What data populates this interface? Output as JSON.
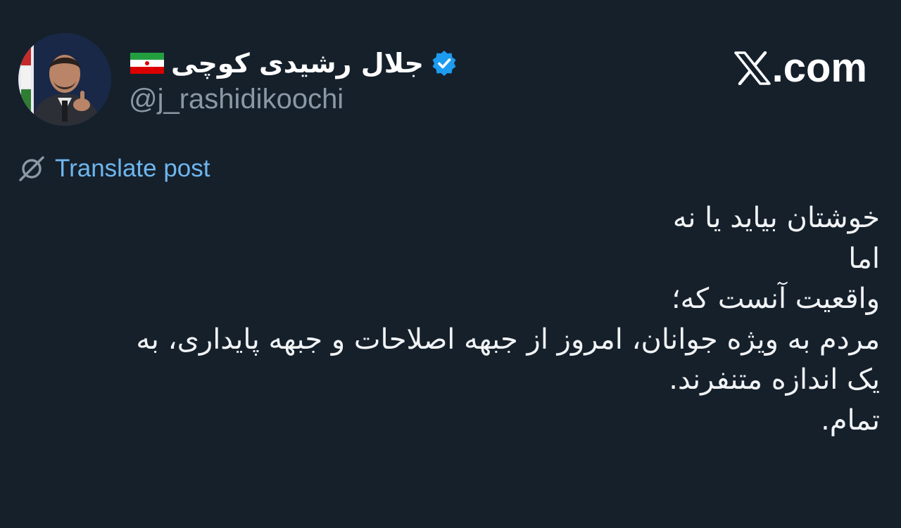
{
  "author": {
    "display_name": "جلال رشیدی کوچی",
    "handle": "@j_rashidikoochi",
    "flag_icon": "iran-flag-icon",
    "verified_icon": "verified-badge-icon",
    "avatar_icon": "profile-photo"
  },
  "brand": {
    "logo_icon": "x-logo-icon",
    "suffix": ".com"
  },
  "translate": {
    "icon": "globe-translate-icon",
    "label": "Translate post"
  },
  "post": {
    "lines": [
      "خوشتان بیاید یا نه",
      "اما",
      "واقعیت آنست که؛",
      "مردم به ویژه جوانان، امروز از جبهه اصلاحات و جبهه پایداری، به",
      "یک اندازه متنفرند.",
      "تمام."
    ]
  },
  "colors": {
    "background": "#15202b",
    "text": "#f1f3f5",
    "muted": "#8b98a5",
    "link": "#6fb6ee",
    "verified": "#1d9bf0"
  }
}
